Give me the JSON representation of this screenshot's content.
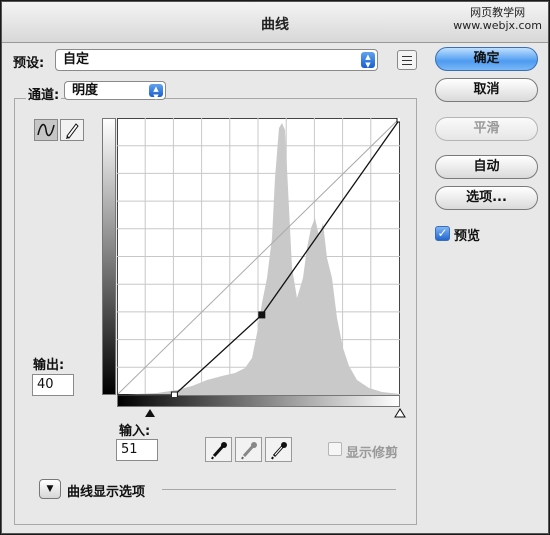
{
  "window": {
    "title": "曲线",
    "watermark_line1": "网页教学网",
    "watermark_line2": "www.webjx.com"
  },
  "preset": {
    "label": "预设:",
    "value": "自定"
  },
  "channel": {
    "label": "通道:",
    "value": "明度"
  },
  "buttons": {
    "ok": "确定",
    "cancel": "取消",
    "smooth": "平滑",
    "auto": "自动",
    "options": "选项..."
  },
  "preview": {
    "label": "预览",
    "checked": true
  },
  "output": {
    "label": "输出:",
    "value": "40"
  },
  "input": {
    "label": "输入:",
    "value": "51"
  },
  "show_clipping": {
    "label": "显示修剪",
    "checked": false
  },
  "curve_display_options": {
    "label": "曲线显示选项"
  },
  "curve": {
    "points": [
      [
        51,
        0
      ],
      [
        130,
        74
      ],
      [
        255,
        255
      ]
    ],
    "selected_point": [
      130,
      74
    ]
  },
  "colors": {
    "accent": "#2f78e0",
    "histogram": "#c9c9c9"
  },
  "icons": [
    "curve-tool-icon",
    "pencil-tool-icon",
    "black-eyedropper-icon",
    "gray-eyedropper-icon",
    "white-eyedropper-icon",
    "panel-menu-icon",
    "disclosure-triangle-icon"
  ]
}
